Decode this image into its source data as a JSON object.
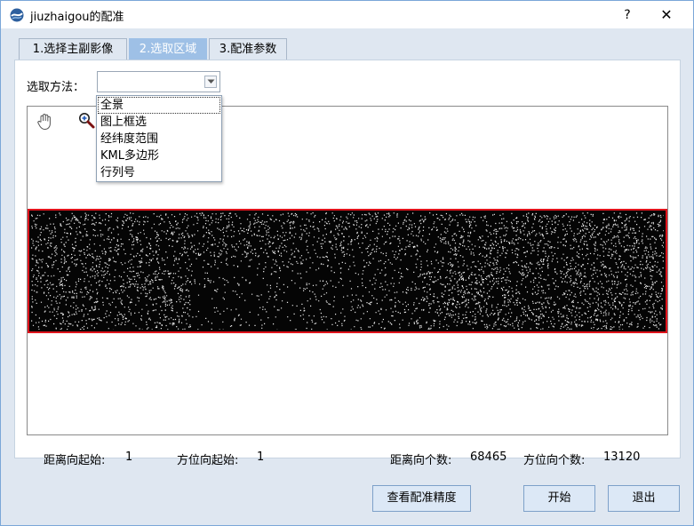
{
  "window": {
    "title": "jiuzhaigou的配准",
    "help_label": "?",
    "close_label": "✕"
  },
  "tabs": [
    {
      "label": "1.选择主副影像",
      "active": false
    },
    {
      "label": "2.选取区域",
      "active": true
    },
    {
      "label": "3.配准参数",
      "active": false
    }
  ],
  "selection": {
    "method_label": "选取方法：",
    "current_value": "",
    "options": [
      "全景",
      "图上框选",
      "经纬度范围",
      "KML多边形",
      "行列号"
    ],
    "highlighted_option": "全景"
  },
  "viewer": {
    "tools": [
      "hand-pan-icon",
      "zoom-in-icon"
    ],
    "frame_color": "#e0141c"
  },
  "info": {
    "range_start_label": "距离向起始:",
    "range_start_value": "1",
    "azimuth_start_label": "方位向起始:",
    "azimuth_start_value": "1",
    "range_count_label": "距离向个数:",
    "range_count_value": "68465",
    "azimuth_count_label": "方位向个数:",
    "azimuth_count_value": "13120"
  },
  "buttons": {
    "check_precision": "查看配准精度",
    "start": "开始",
    "exit": "退出"
  },
  "colors": {
    "active_tab": "#9ec0e6",
    "button_bg": "#dce8f6",
    "window_border": "#7aa7d8"
  }
}
